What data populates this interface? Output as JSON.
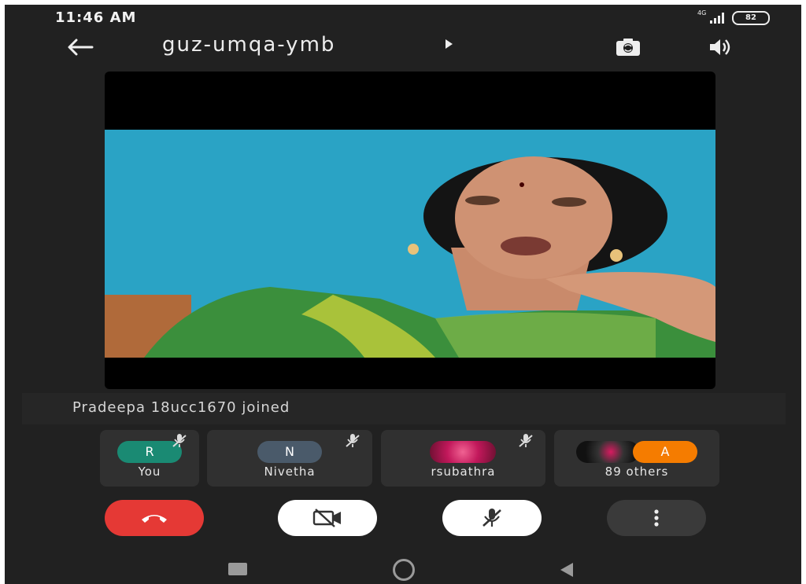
{
  "status_bar": {
    "time": "11:46 AM",
    "network": "4G",
    "battery": "82"
  },
  "header": {
    "meeting_code": "guz-umqa-ymb"
  },
  "notice": {
    "text": "Pradeepa 18ucc1670 joined"
  },
  "participants": [
    {
      "initial": "R",
      "name": "You",
      "avatar_color": "#1a8a73",
      "muted": true
    },
    {
      "initial": "N",
      "name": "Nivetha",
      "avatar_color": "#4a5a6a",
      "muted": true
    },
    {
      "initial": "",
      "name": "rsubathra",
      "avatar_color": "#c2185b",
      "muted": true
    },
    {
      "initial": "A",
      "name": "89 others",
      "avatar_color": "#f57c00",
      "muted": true
    }
  ],
  "controls": {
    "end_call_color": "#e53935",
    "button_color": "#ffffff",
    "more_color": "#3a3a3a"
  },
  "colors": {
    "background": "#212121",
    "tile": "#303030",
    "accent_red": "#e53935"
  }
}
